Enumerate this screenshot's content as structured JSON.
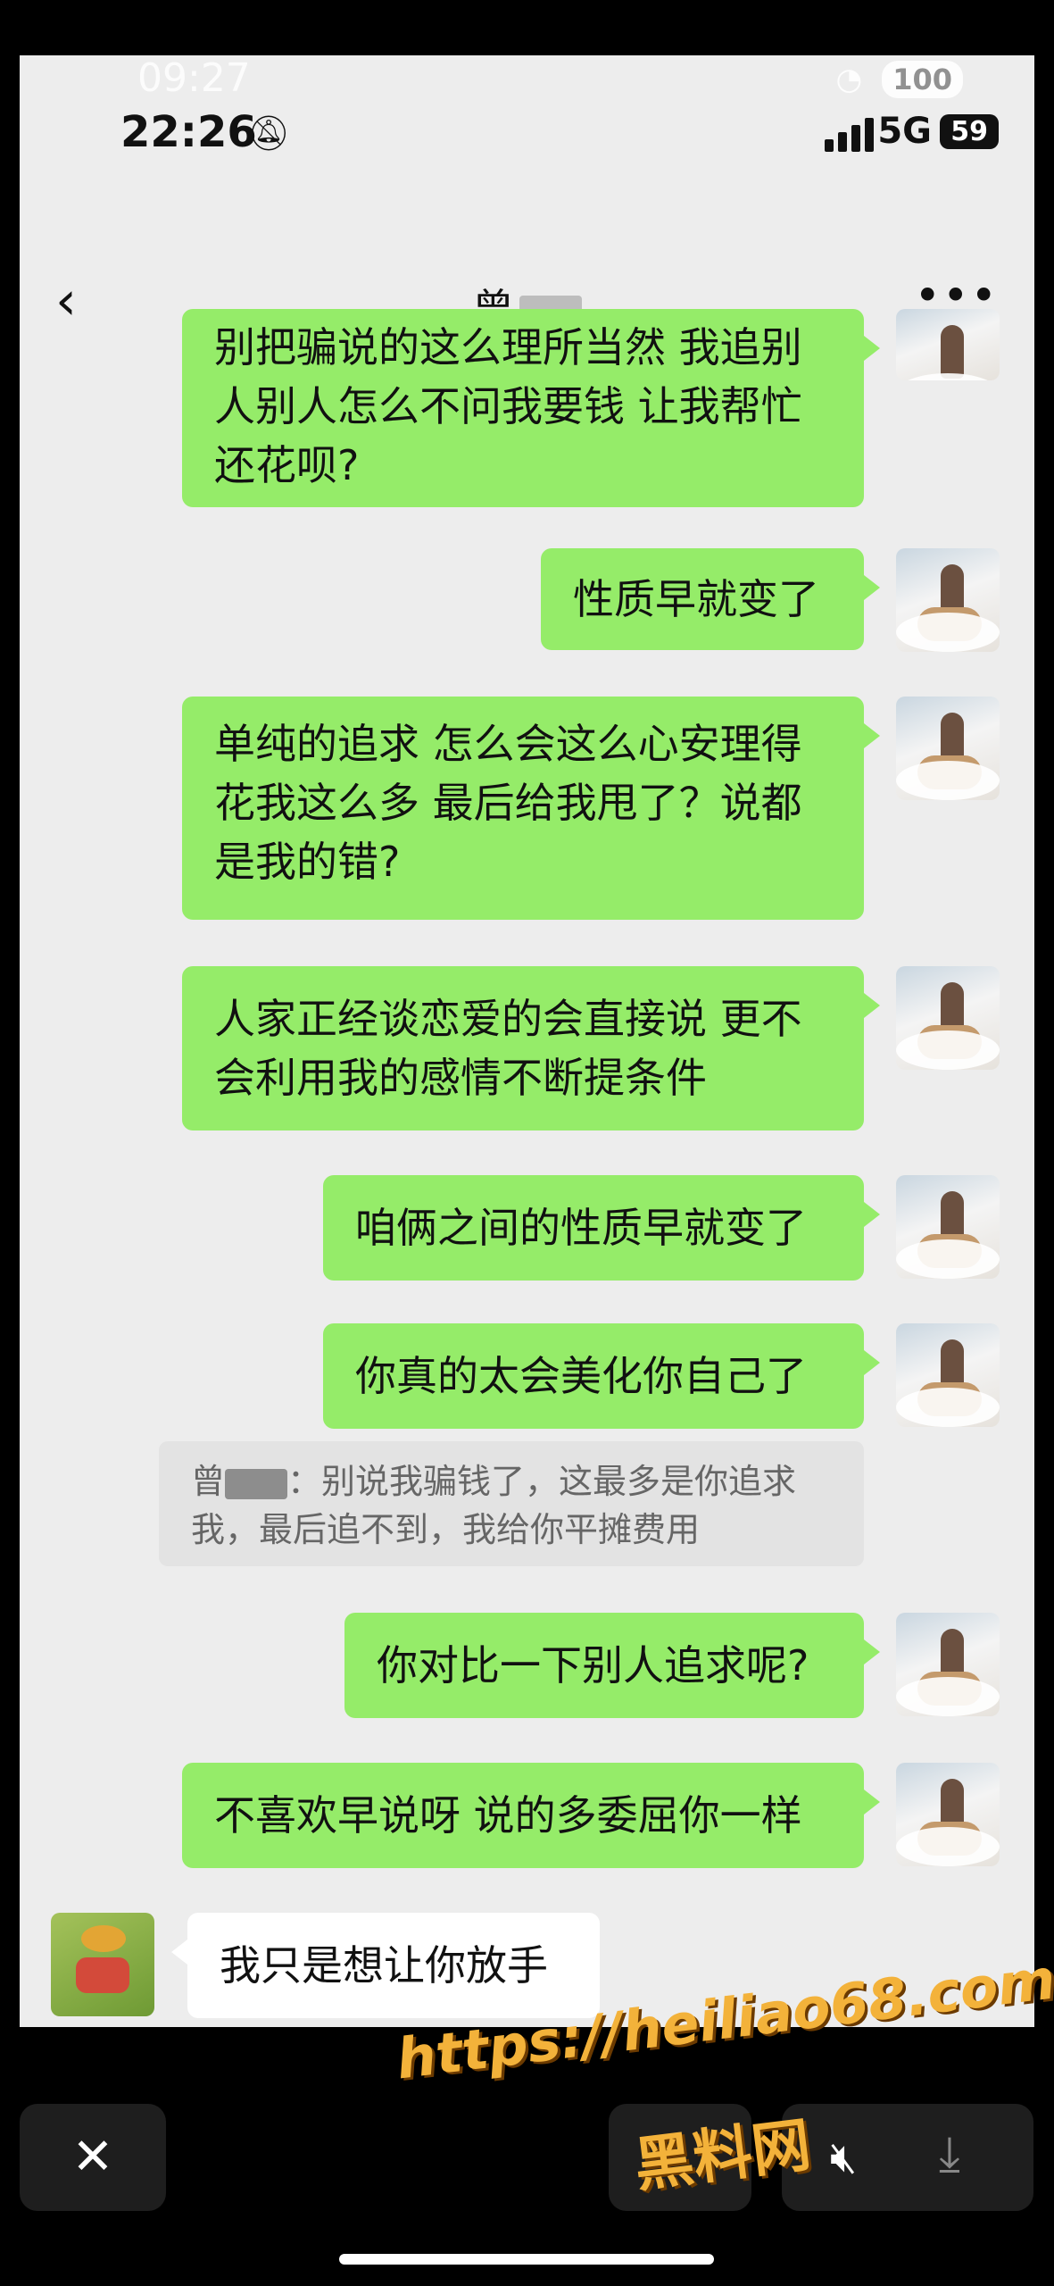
{
  "outer_status": {
    "time": "09:27",
    "battery": "100"
  },
  "status_bar": {
    "time": "22:26",
    "network": "5G",
    "battery": "59"
  },
  "header": {
    "title": "曾",
    "back_icon": "chevron-left-icon",
    "more_icon": "more-dots-icon"
  },
  "messages": [
    {
      "side": "me",
      "text": "别把骗说的这么理所当然 我追别人别人怎么不问我要钱 让我帮忙还花呗?"
    },
    {
      "side": "me",
      "text": "性质早就变了"
    },
    {
      "side": "me",
      "text": "单纯的追求 怎么会这么心安理得花我这么多 最后给我甩了？说都是我的错?"
    },
    {
      "side": "me",
      "text": "人家正经谈恋爱的会直接说 更不会利用我的感情不断提条件"
    },
    {
      "side": "me",
      "text": "咱俩之间的性质早就变了"
    },
    {
      "side": "me",
      "text": "你真的太会美化你自己了"
    },
    {
      "side": "me",
      "text": "你对比一下别人追求呢?"
    },
    {
      "side": "me",
      "text": "不喜欢早说呀 说的多委屈你一样"
    },
    {
      "side": "them",
      "text": "我只是想让你放手"
    }
  ],
  "quote": {
    "sender": "曾",
    "text": "：别说我骗钱了，这最多是你追求我，最后追不到，我给你平摊费用"
  },
  "bottom_bar": {
    "close_icon": "close-icon",
    "mute_icon": "mute-icon",
    "download_icon": "download-icon"
  },
  "watermark": {
    "url": "https://heiliao68.com",
    "name": "黑料网"
  }
}
